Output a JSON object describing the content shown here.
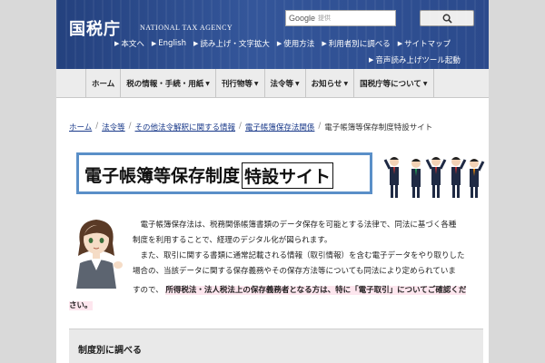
{
  "header": {
    "logo": "国税庁",
    "logo_en": "NATIONAL TAX AGENCY",
    "search": {
      "brand": "Google",
      "placeholder": "提供",
      "button_icon": "search-icon"
    },
    "utility_links": [
      "本文へ",
      "English",
      "読み上げ・文字拡大",
      "使用方法",
      "利用者別に調べる",
      "サイトマップ"
    ],
    "audio_tool": "音声読み上げツール起動"
  },
  "nav": {
    "items": [
      "ホーム",
      "税の情報・手続・用紙",
      "刊行物等",
      "法令等",
      "お知らせ",
      "国税庁等について"
    ]
  },
  "breadcrumb": {
    "items": [
      "ホーム",
      "法令等",
      "その他法令解釈に関する情報",
      "電子帳簿保存法関係"
    ],
    "current": "電子帳簿等保存制度特設サイト"
  },
  "banner": {
    "title_a": "電子帳簿等保存制度",
    "title_b": "特設サイト"
  },
  "intro": {
    "line1": "電子帳簿保存法は、税務関係帳簿書類のデータ保存を可能とする法律で、同法に基づく各種",
    "line2": "制度を利用することで、経理のデジタル化が図られます。",
    "line3": "また、取引に関する書類に通常記載される情報（取引情報）を含む電子データをやり取りした",
    "line4": "場合の、当該データに関する保存義務やその保存方法等についても同法により定められていま",
    "line5_prefix": "すので、",
    "emphasis_a": "所得税法・法人税法上の保存義務者となる方は、特に「電子取引」についてご確認くだ",
    "emphasis_b": "さい。"
  },
  "section": {
    "title": "制度別に調べる"
  }
}
